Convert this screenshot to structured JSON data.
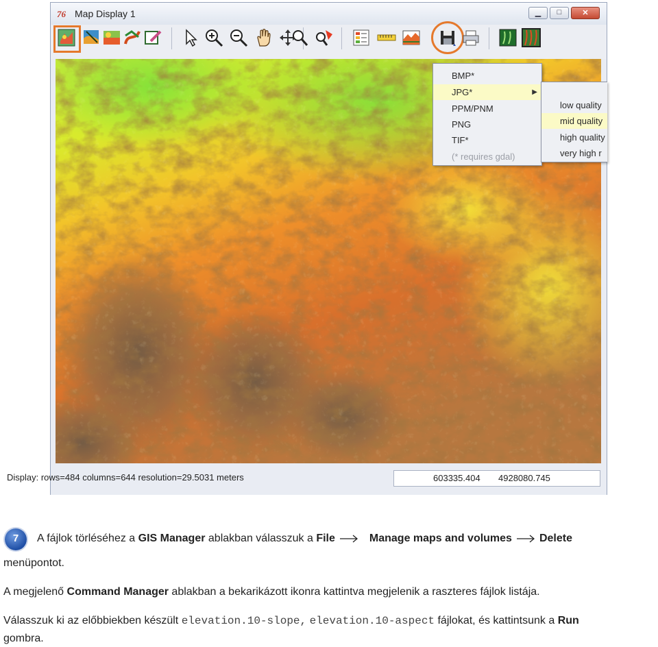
{
  "window": {
    "title": "Map Display 1",
    "logo": "76",
    "controls": {
      "minimize": "▁",
      "maximize": "□",
      "close": "✕"
    }
  },
  "toolbar": {
    "icons": [
      "display-map-icon",
      "overlay-icon",
      "raster-layer-icon",
      "vector-layer-icon",
      "erase-icon",
      "pointer-icon",
      "zoom-in-icon",
      "zoom-out-icon",
      "pan-icon",
      "query-icon",
      "analyze-icon",
      "legend-icon",
      "scale-bar-icon",
      "profile-icon",
      "save-icon",
      "print-icon",
      "3d-view-icon",
      "nviz-icon"
    ]
  },
  "file_menu": {
    "items": [
      "BMP*",
      "JPG*",
      "PPM/PNM",
      "PNG",
      "TIF*",
      "(* requires gdal)"
    ],
    "selected": "JPG*",
    "disabled": "(* requires gdal)"
  },
  "quality_menu": {
    "items": [
      "low quality",
      "mid quality",
      "high quality",
      "very high r"
    ],
    "selected": "mid quality"
  },
  "status": {
    "info": "Display: rows=484  columns=644  resolution=29.5031 meters",
    "easting": "603335.404",
    "northing": "4928080.745"
  },
  "instructions": {
    "step_number": "7",
    "p1_a": "A fájlok törléséhez a ",
    "p1_gis": "GIS Manager",
    "p1_b": " ablakban válasszuk a ",
    "p1_file": "File",
    "p1_manage": "Manage maps and volumes",
    "p1_delete": "Delete",
    "p1_end": "menüpontot.",
    "p2_a": "A megjelenő ",
    "p2_cmd": "Command Manager",
    "p2_b": " ablakban a bekarikázott ikonra kattintva megjelenik a raszteres fájlok listája.",
    "p3_a": "Válasszuk ki az előbbiekben készült ",
    "p3_file1": "elevation.10-slope,",
    "p3_file2": "elevation.10-aspect",
    "p3_b": " fájlokat, és kattintsunk a ",
    "p3_run": "Run",
    "p3_end": "gombra."
  }
}
